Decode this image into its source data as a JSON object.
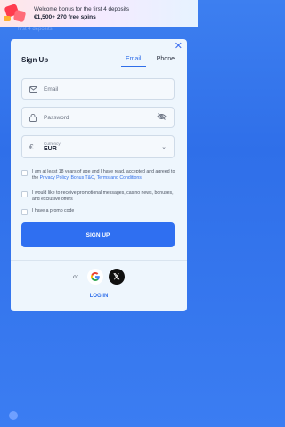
{
  "banner": {
    "line1": "Welcome bonus for the first 4 deposits",
    "line2": "€1,500+ 270 free spins",
    "gift_icon": "gift-icon"
  },
  "background": {
    "text": "first 4 deposits"
  },
  "modal": {
    "title": "Sign Up",
    "close_icon": "close-icon",
    "tabs": [
      {
        "label": "Email",
        "active": true
      },
      {
        "label": "Phone",
        "active": false
      }
    ],
    "email": {
      "placeholder": "Email",
      "icon": "mail-icon"
    },
    "password": {
      "placeholder": "Password",
      "icon": "lock-icon",
      "toggle_icon": "eye-off-icon"
    },
    "currency": {
      "label": "Currency",
      "value": "EUR",
      "icon": "euro-icon"
    },
    "checks": {
      "age": {
        "text_start": "I am at least 18 years of age and I have read, accepted and agreed to the ",
        "link1": "Privacy Policy",
        "sep": ", ",
        "link2": "Bonus T&C",
        "sep2": ", ",
        "link3": "Terms and Conditions"
      },
      "promo_msgs": "I would like to receive promotional messages, casino news, bonuses, and exclusive offers",
      "promo_code": "I have a promo code"
    },
    "signup_label": "SIGN UP",
    "or_label": "or",
    "login_label": "LOG IN"
  },
  "colors": {
    "accent": "#2f6ff1",
    "background": "#3d7ff0",
    "modal": "#eef6fd"
  }
}
